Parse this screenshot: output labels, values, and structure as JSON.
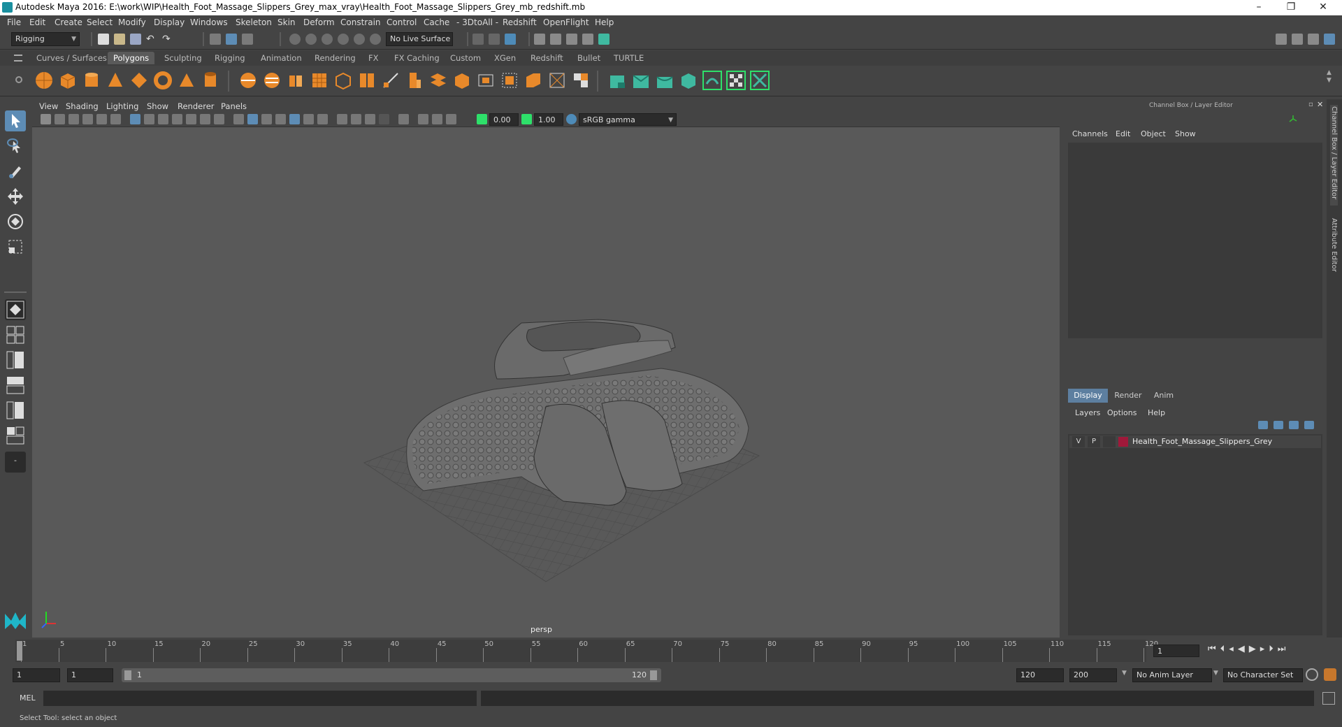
{
  "window": {
    "title": "Autodesk Maya 2016: E:\\work\\WIP\\Health_Foot_Massage_Slippers_Grey_max_vray\\Health_Foot_Massage_Slippers_Grey_mb_redshift.mb",
    "minimize": "–",
    "maximize": "❐",
    "close": "✕"
  },
  "menubar": [
    "File",
    "Edit",
    "Create",
    "Select",
    "Modify",
    "Display",
    "Windows",
    "Skeleton",
    "Skin",
    "Deform",
    "Constrain",
    "Control",
    "Cache",
    "- 3DtoAll -",
    "Redshift",
    "OpenFlight",
    "Help"
  ],
  "status_line": {
    "menuset": "Rigging",
    "live_surface": "No Live Surface"
  },
  "shelf_tabs": [
    "Curves / Surfaces",
    "Polygons",
    "Sculpting",
    "Rigging",
    "Animation",
    "Rendering",
    "FX",
    "FX Caching",
    "Custom",
    "XGen",
    "Redshift",
    "Bullet",
    "TURTLE"
  ],
  "shelf_active": "Polygons",
  "viewport": {
    "menus": [
      "View",
      "Shading",
      "Lighting",
      "Show",
      "Renderer",
      "Panels"
    ],
    "exposure": "0.00",
    "gamma": "1.00",
    "color_space": "sRGB gamma",
    "camera_label": "persp"
  },
  "channel_box": {
    "title": "Channel Box / Layer Editor",
    "menus": [
      "Channels",
      "Edit",
      "Object",
      "Show"
    ]
  },
  "layer_editor": {
    "tabs": [
      "Display",
      "Render",
      "Anim"
    ],
    "active_tab": "Display",
    "menus": [
      "Layers",
      "Options",
      "Help"
    ],
    "layers": [
      {
        "visible": "V",
        "playback": "P",
        "color": "#a0193a",
        "name": "Health_Foot_Massage_Slippers_Grey"
      }
    ]
  },
  "side_tabs": [
    "Channel Box / Layer Editor",
    "Attribute Editor"
  ],
  "timeline": {
    "ticks": [
      "1",
      "5",
      "10",
      "15",
      "20",
      "25",
      "30",
      "35",
      "40",
      "45",
      "50",
      "55",
      "60",
      "65",
      "70",
      "75",
      "80",
      "85",
      "90",
      "95",
      "100",
      "105",
      "110",
      "115",
      "120"
    ],
    "current_frame": "1"
  },
  "range": {
    "start": "1",
    "playback_start": "1",
    "slider_start": "1",
    "slider_end": "120",
    "playback_end": "120",
    "end": "200",
    "anim_layer": "No Anim Layer",
    "character_set": "No Character Set"
  },
  "command_line": {
    "label": "MEL"
  },
  "help_line": "Select Tool: select an object"
}
